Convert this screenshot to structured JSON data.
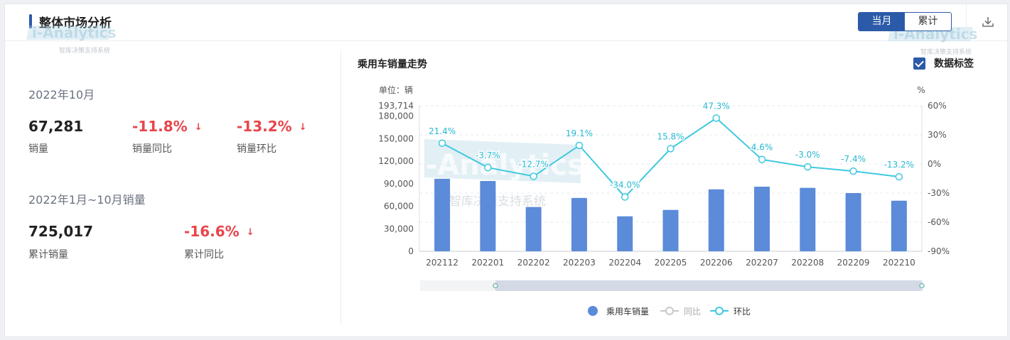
{
  "header": {
    "title": "整体市场分析",
    "watermark_text": "i-Analytics",
    "watermark_sub": "智库决策支持系统",
    "tabs": [
      {
        "label": "当月",
        "active": true
      },
      {
        "label": "累计",
        "active": false
      }
    ]
  },
  "kpi": {
    "monthly": {
      "period": "2022年10月",
      "sales": {
        "value": "67,281",
        "label": "销量"
      },
      "yoy": {
        "value": "-11.8%",
        "label": "销量同比",
        "arrow": "↓"
      },
      "mom": {
        "value": "-13.2%",
        "label": "销量环比",
        "arrow": "↓"
      }
    },
    "cumulative": {
      "period": "2022年1月~10月销量",
      "sales": {
        "value": "725,017",
        "label": "累计销量"
      },
      "yoy": {
        "value": "-16.6%",
        "label": "累计同比",
        "arrow": "↓"
      }
    }
  },
  "chart_header": {
    "title": "乘用车销量走势",
    "checkbox_label": "数据标签",
    "checkbox_checked": true
  },
  "chart_data": {
    "type": "bar",
    "categories": [
      "202112",
      "202201",
      "202202",
      "202203",
      "202204",
      "202205",
      "202206",
      "202207",
      "202208",
      "202209",
      "202210"
    ],
    "series": [
      {
        "name": "乘用车销量",
        "kind": "bar",
        "axis": "left",
        "color": "#5b8bd9",
        "values": [
          96500,
          93500,
          59000,
          71000,
          46500,
          55000,
          82500,
          86000,
          84500,
          77500,
          67281
        ]
      },
      {
        "name": "同比",
        "kind": "line",
        "axis": "right",
        "color": "#c8c8c8",
        "values": []
      },
      {
        "name": "环比",
        "kind": "line",
        "axis": "right",
        "color": "#3ec9e0",
        "values": [
          21.4,
          -3.7,
          -12.7,
          19.1,
          -34.0,
          15.8,
          47.3,
          4.6,
          -3.0,
          -7.4,
          -13.2
        ],
        "labels": [
          "21.4%",
          "-3.7%",
          "-12.7%",
          "19.1%",
          "-34.0%",
          "15.8%",
          "47.3%",
          "4.6%",
          "-3.0%",
          "-7.4%",
          "-13.2%"
        ]
      }
    ],
    "left_axis": {
      "unit_label": "单位：辆",
      "max": 193714,
      "ticks": [
        0,
        30000,
        60000,
        90000,
        120000,
        150000,
        180000,
        193714
      ],
      "tick_labels": [
        "0",
        "30,000",
        "60,000",
        "90,000",
        "120,000",
        "150,000",
        "180,000",
        "193,714"
      ]
    },
    "right_axis": {
      "unit_label": "%",
      "min": -90,
      "max": 60,
      "ticks": [
        -90,
        -60,
        -30,
        0,
        30,
        60
      ],
      "tick_labels": [
        "-90%",
        "-60%",
        "-30%",
        "0%",
        "30%",
        "60%"
      ]
    },
    "legend": [
      "乘用车销量",
      "同比",
      "环比"
    ],
    "legend_position": "bottom",
    "grid": true,
    "colors": {
      "bar": "#5b8bd9",
      "mom_line": "#3ec9e0",
      "yoy_line": "#c8c8c8",
      "accent": "#2b5aa8",
      "negative": "#e8454b"
    }
  }
}
